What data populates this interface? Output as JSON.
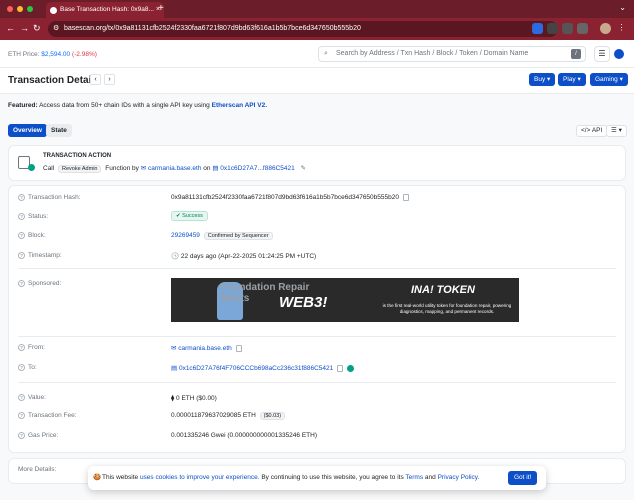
{
  "browser": {
    "tab_title": "Base Transaction Hash: 0x9a8...",
    "tab_close": "×",
    "new_tab": "+",
    "url": "basescan.org/tx/0x9a81131cfb2524f2330faa6721f807d9bd63f616a1b5b7bce6d347650b555b20",
    "back": "←",
    "forward": "→",
    "reload": "↻"
  },
  "header": {
    "eth_label": "ETH Price:",
    "eth_price": "$2,594.00",
    "eth_change": "(-2.98%)",
    "search_placeholder": "Search by Address / Txn Hash / Block / Token / Domain Name",
    "slash_key": "/",
    "menu_icon": "☰"
  },
  "title_bar": {
    "title": "Transaction Details",
    "prev": "‹",
    "next": "›",
    "buttons": [
      "Buy ▾",
      "Play ▾",
      "Gaming ▾"
    ]
  },
  "featured": {
    "label": "Featured:",
    "text": "Access data from 50+ chain IDs with a single API key using",
    "link": "Etherscan API V2."
  },
  "tabs": {
    "overview": "Overview",
    "state": "State",
    "api": "</> API",
    "grid": "☰ ▾"
  },
  "action": {
    "label": "TRANSACTION ACTION",
    "call": "Call",
    "method": "Revoke Admin",
    "function_by": "Function by",
    "by_name": "carmania.base.eth",
    "on": "on",
    "contract": "0x1c6D27A7...f886C5421",
    "edit_icon": "✎"
  },
  "details": {
    "hash_label": "Transaction Hash:",
    "hash": "0x9a81131cfb2524f2330faa6721f807d9bd63f616a1b5b7bce6d347650b555b20",
    "status_label": "Status:",
    "status": "✔ Success",
    "block_label": "Block:",
    "block": "29269459",
    "block_badge": "Confirmed by Sequencer",
    "timestamp_label": "Timestamp:",
    "timestamp": "🕓 22 days ago (Apr-22-2025 01:24:25 PM +UTC)",
    "sponsored_label": "Sponsored:",
    "from_label": "From:",
    "from": "carmania.base.eth",
    "to_label": "To:",
    "to": "0x1c6D27A76f4F706CCCb698aCc236c31f886C5421",
    "value_label": "Value:",
    "value": "⧫ 0 ETH ($0.00)",
    "fee_label": "Transaction Fee:",
    "fee": "0.000011879637029085 ETH",
    "fee_usd": "($0.03)",
    "gas_label": "Gas Price:",
    "gas": "0.001335246 Gwei (0.000000000001335246 ETH)",
    "more_label": "More Details:",
    "q": "?"
  },
  "ad": {
    "line1": "Foundation Repair",
    "line2": "Meets",
    "web3": "WEB3!",
    "token": "INA! TOKEN",
    "tagline": "is the first real-world utility token for foundation repair, powering diagnostics, mapping, and permanent records."
  },
  "cookie": {
    "icon": "🍪",
    "text1": "This website",
    "link1": "uses cookies to improve your experience.",
    "text2": "By continuing to use this website, you agree to its",
    "terms": "Terms",
    "and": "and",
    "privacy": "Privacy Policy.",
    "button": "Got it!"
  }
}
